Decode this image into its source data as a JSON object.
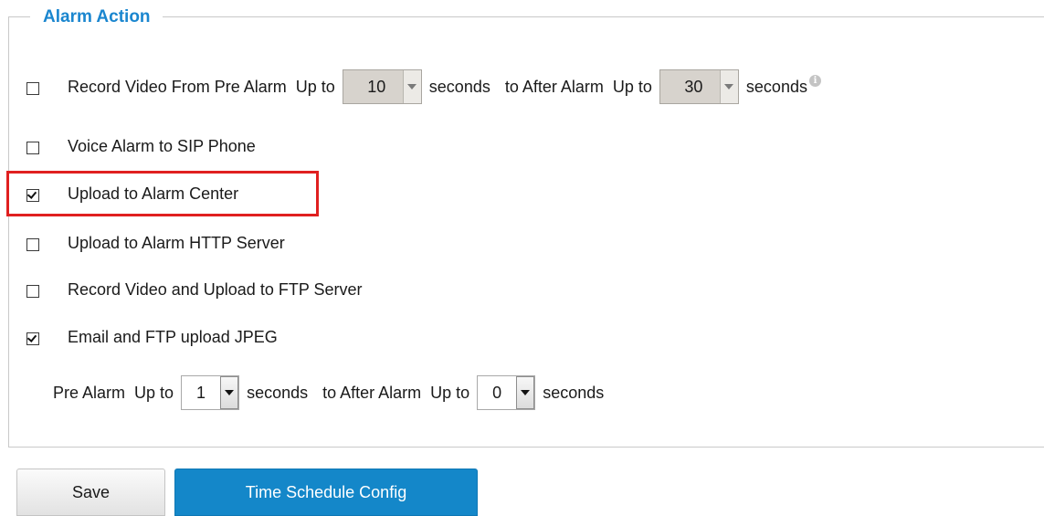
{
  "section": {
    "title": "Alarm Action"
  },
  "rows": [
    {
      "checked": false,
      "label": "Record Video From Pre Alarm",
      "up_to_1": "Up to",
      "pre_value": "10",
      "seconds_1": "seconds",
      "after_label": "to After Alarm",
      "up_to_2": "Up to",
      "post_value": "30",
      "seconds_2": "seconds",
      "disabled": true
    },
    {
      "checked": false,
      "label": "Voice Alarm to SIP Phone"
    },
    {
      "checked": true,
      "label": "Upload to Alarm Center",
      "highlighted": true
    },
    {
      "checked": false,
      "label": "Upload to Alarm HTTP Server"
    },
    {
      "checked": false,
      "label": "Record Video and Upload to FTP Server"
    },
    {
      "checked": true,
      "label": "Email and FTP upload JPEG"
    }
  ],
  "jpeg_timing": {
    "pre_label": "Pre Alarm",
    "up_to_1": "Up to",
    "pre_value": "1",
    "seconds_1": "seconds",
    "after_label": "to After Alarm",
    "up_to_2": "Up to",
    "post_value": "0",
    "seconds_2": "seconds"
  },
  "buttons": {
    "save": "Save",
    "time_schedule": "Time Schedule Config"
  },
  "colors": {
    "section_title": "#1a86cf",
    "primary_button": "#1487c9",
    "highlight": "#e02020"
  },
  "icons": [
    "info-icon",
    "dropdown-arrow-icon"
  ]
}
